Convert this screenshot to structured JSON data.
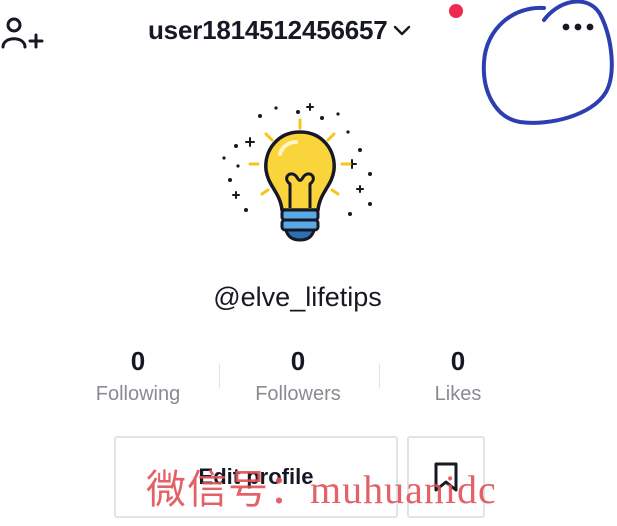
{
  "header": {
    "username": "user1814512456657",
    "add_user_icon": "add-user-icon",
    "dropdown_icon": "chevron-down-icon",
    "more_icon": "more-dots-icon",
    "notification_color": "#ef2950"
  },
  "profile": {
    "avatar_icon": "lightbulb-avatar",
    "handle": "@elve_lifetips"
  },
  "stats": [
    {
      "value": "0",
      "label": "Following"
    },
    {
      "value": "0",
      "label": "Followers"
    },
    {
      "value": "0",
      "label": "Likes"
    }
  ],
  "actions": {
    "edit_profile_label": "Edit profile",
    "bookmark_icon": "bookmark-icon"
  },
  "overlay": {
    "watermark_text": "微信号：muhuanidc",
    "watermark_color": "#e05257",
    "annotation_color": "#2b3fb0"
  }
}
